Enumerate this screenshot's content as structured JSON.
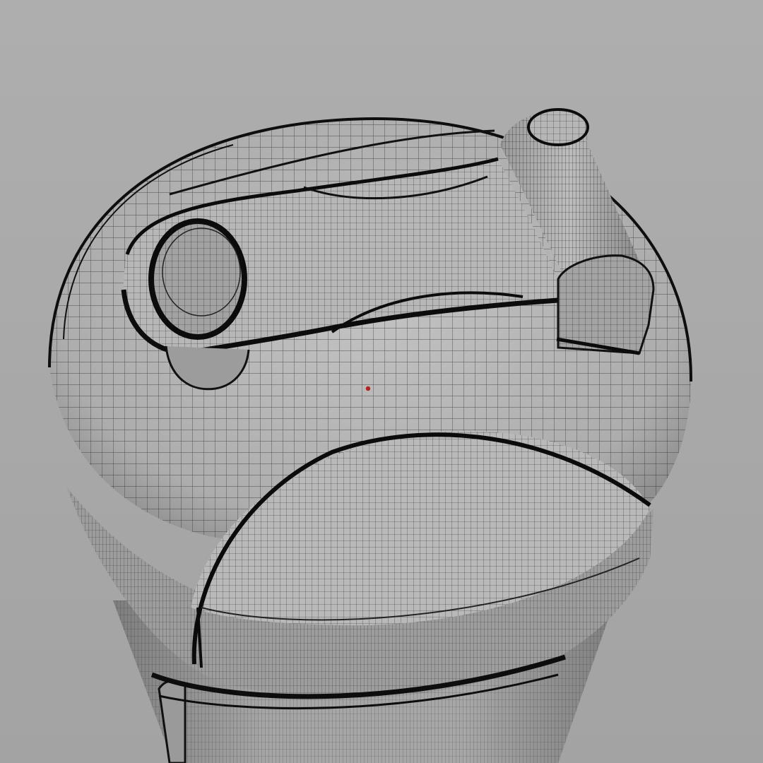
{
  "viewport": {
    "background_color": "#a9a9a9",
    "model_fill_color": "#b4b4b4",
    "wire_color": "#111111",
    "origin_marker_color": "#b22222"
  },
  "icons": {
    "origin_marker": "origin-dot-icon"
  }
}
